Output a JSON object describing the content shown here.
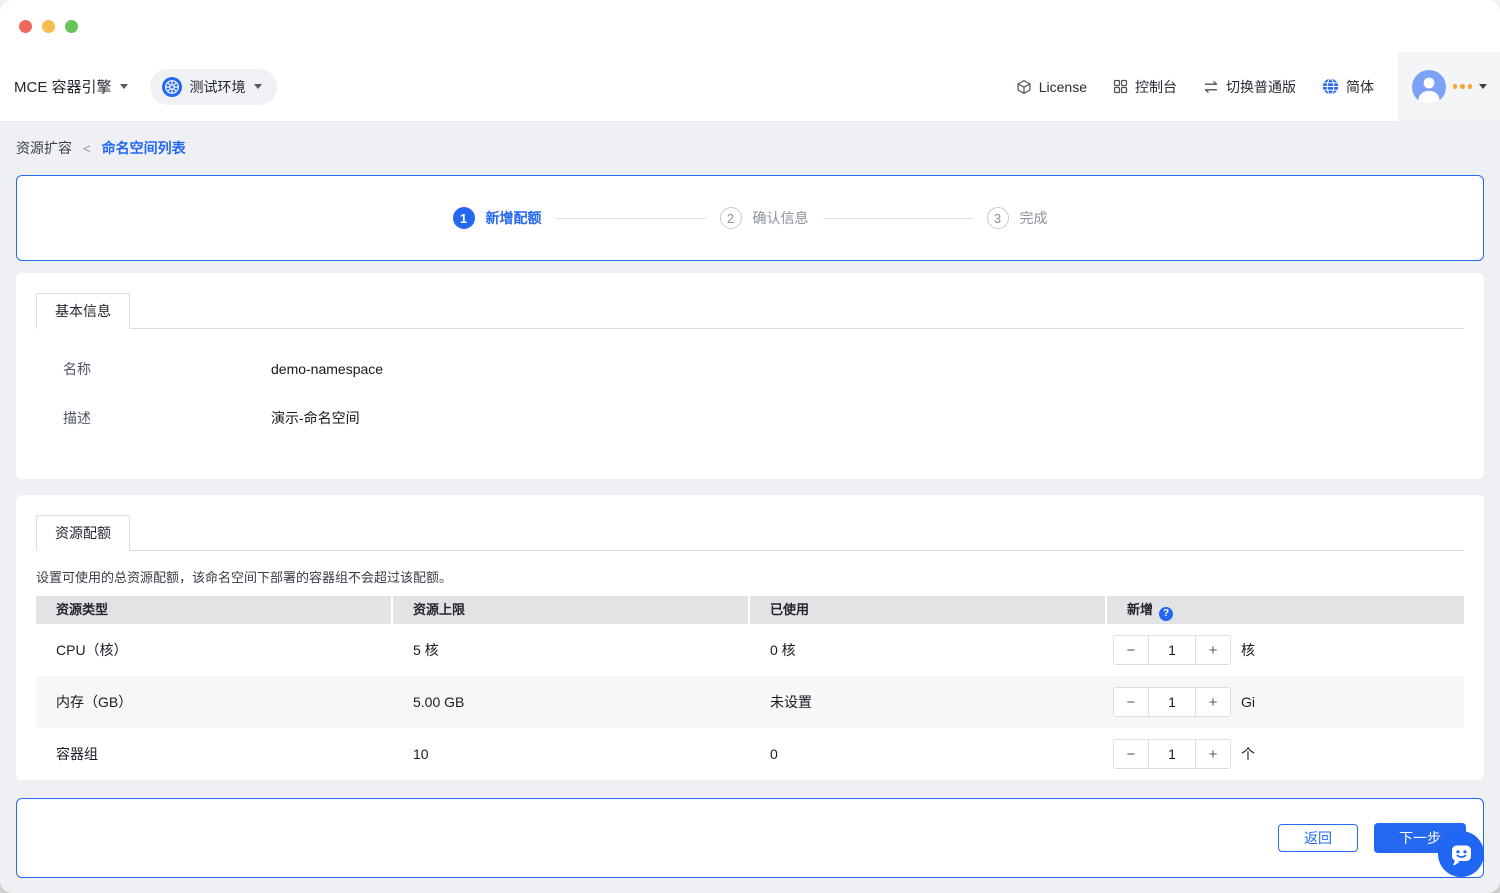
{
  "colors": {
    "primary": "#2468F2",
    "page_bg": "#EEF0F3",
    "table_header_bg": "#E2E3E5",
    "zebra_row_bg": "#F7F7F8",
    "avatar_bg": "#7CA1F6",
    "dots_orange": "#F7A832",
    "traffic_red": "#EE6A5F",
    "traffic_yellow": "#F5BD4E",
    "traffic_green": "#62C554"
  },
  "header": {
    "brand": "MCE 容器引擎",
    "environment": "测试环境",
    "nav": {
      "license": "License",
      "console": "控制台",
      "switch_edition": "切换普通版",
      "language": "简体"
    }
  },
  "breadcrumb": {
    "current": "资源扩容",
    "separator": "<",
    "link": "命名空间列表"
  },
  "stepper": {
    "steps": [
      {
        "num": "1",
        "label": "新增配额"
      },
      {
        "num": "2",
        "label": "确认信息"
      },
      {
        "num": "3",
        "label": "完成"
      }
    ]
  },
  "basic_info": {
    "tab": "基本信息",
    "fields": [
      {
        "label": "名称",
        "value": "demo-namespace"
      },
      {
        "label": "描述",
        "value": "演示-命名空间"
      }
    ]
  },
  "quota": {
    "tab": "资源配额",
    "description": "设置可使用的总资源配额，该命名空间下部署的容器组不会超过该配额。",
    "help_icon": "?",
    "controls": {
      "minus": "−",
      "plus": "+"
    },
    "table": {
      "headers": [
        "资源类型",
        "资源上限",
        "已使用",
        "新增"
      ],
      "rows": [
        {
          "type": "CPU（核）",
          "limit": "5 核",
          "used": "0 核",
          "add": "1",
          "unit": "核"
        },
        {
          "type": "内存（GB）",
          "limit": "5.00 GB",
          "used": "未设置",
          "add": "1",
          "unit": "Gi"
        },
        {
          "type": "容器组",
          "limit": "10",
          "used": "0",
          "add": "1",
          "unit": "个"
        }
      ]
    }
  },
  "footer": {
    "back": "返回",
    "next": "下一步"
  }
}
